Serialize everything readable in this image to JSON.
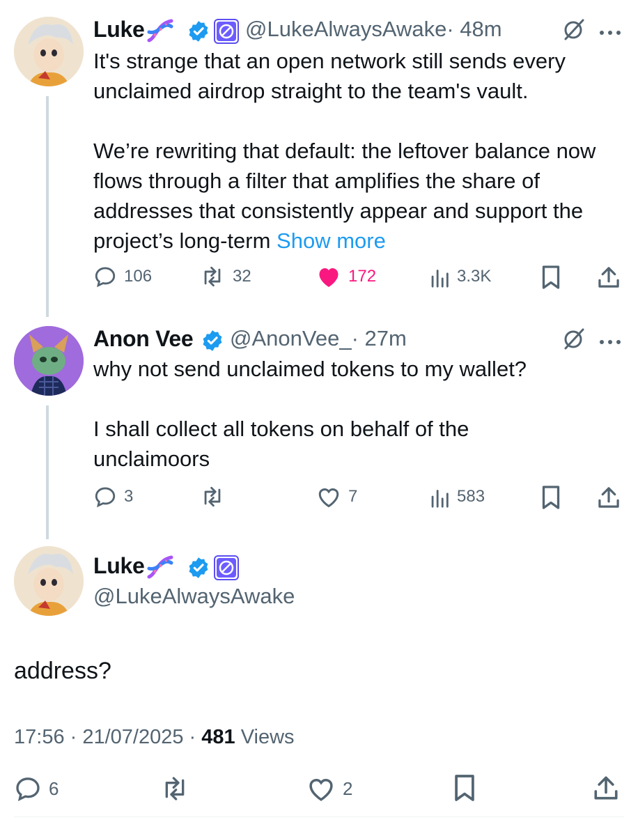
{
  "colors": {
    "accent": "#1d9bf0",
    "like": "#f91880",
    "muted": "#536471",
    "verified": "#1d9bf0"
  },
  "tweet1": {
    "name": "Luke",
    "handle": "@LukeAlwaysAwake",
    "time": "· 48m",
    "text": "It's strange that an open network still sends every unclaimed airdrop straight to the team's vault.\n\nWe’re rewriting that default: the leftover balance now flows through a filter that amplifies the share of addresses that consistently appear and support the project’s long-term ",
    "show_more": "Show more",
    "stats": {
      "replies": "106",
      "reposts": "32",
      "likes": "172",
      "views": "3.3K"
    },
    "liked": true,
    "icons": [
      "dna-emoji-icon",
      "verified-badge-icon",
      "affiliate-badge-icon",
      "grok-icon",
      "more-icon",
      "reply-icon",
      "repost-icon",
      "like-icon",
      "views-icon",
      "bookmark-icon",
      "share-icon"
    ]
  },
  "tweet2": {
    "name": "Anon Vee",
    "handle": "@AnonVee_",
    "time": "· 27m",
    "text": "why not send unclaimed tokens to my wallet?\n\nI shall collect all tokens on behalf of the unclaimoors",
    "stats": {
      "replies": "3",
      "reposts": "",
      "likes": "7",
      "views": "583"
    }
  },
  "main_tweet": {
    "name": "Luke",
    "handle": "@LukeAlwaysAwake",
    "text": "address?",
    "time": "17:56 · 21/07/2025 · ",
    "views_count": "481",
    "views_label": " Views",
    "stats": {
      "replies": "6",
      "reposts": "",
      "likes": "2"
    }
  }
}
